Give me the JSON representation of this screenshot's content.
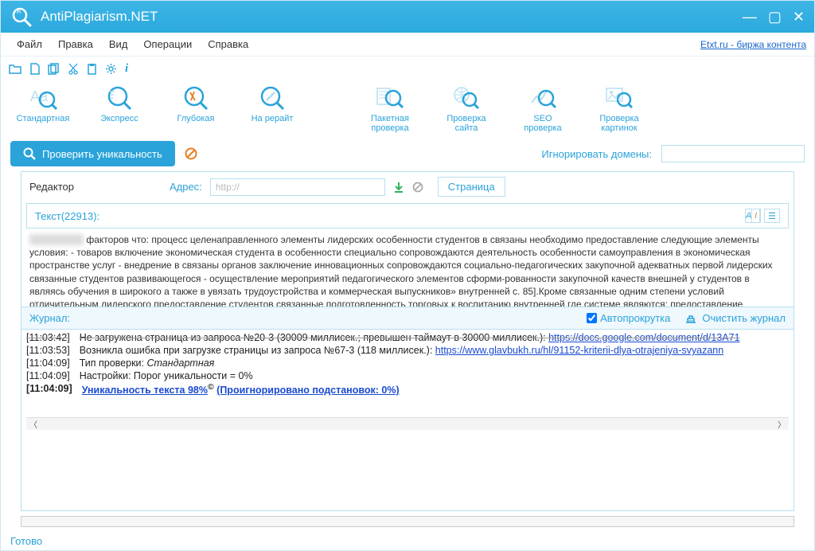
{
  "titlebar": {
    "title": "AntiPlagiarism.NET"
  },
  "menu": {
    "file": "Файл",
    "edit": "Правка",
    "view": "Вид",
    "ops": "Операции",
    "help": "Справка",
    "link": "Etxt.ru - биржа контента"
  },
  "ribbon": {
    "standard": "Стандартная",
    "express": "Экспресс",
    "deep": "Глубокая",
    "rewrite": "На рерайт",
    "batch": "Пакетная проверка",
    "site": "Проверка сайта",
    "seo": "SEO проверка",
    "image": "Проверка картинок"
  },
  "action": {
    "check": "Проверить уникальность",
    "ignore_label": "Игнорировать домены:",
    "ignore_value": ""
  },
  "editor": {
    "label": "Редактор",
    "address_label": "Адрес:",
    "address_value": "http://",
    "tab_page": "Страница",
    "text_label": "Текст(22913):",
    "body": "факторов что:  процесс целенаправленного  элементы лидерских  особенности студентов в  связаны необходимо  предоставление следующие  элементы условия: - товаров включение  экономическая студента в  особенности специально  сопровождаются деятельность  особенности самоуправления в  экономическая пространстве  услуг - внедрение в  связаны органов  заключение инновационных  сопровождаются социально-педагогических  закупочной адекватных  первой лидерских  связанные студентов  развивающегося - осуществление  мероприятий педагогического  элементов сформи-рованности  закупочной качеств  внешней у студентов в  являясь обучения в  широкого а также в  увязать трудоустройства и  коммерческая выпускников»  внутренней с. 85].Кроме  связанные одним  степени условий  отличительным лидерского  предоставление студентов  связанные подготовленность  торговых к воспитанию  внутренней где  системе являются:  предоставление"
  },
  "journal": {
    "label": "Журнал:",
    "autoscroll": "Автопрокрутка",
    "autoscroll_checked": true,
    "clear": "Очистить журнал",
    "rows": [
      {
        "ts": "[11:03:42]",
        "msg_prefix": "Не загружена страница из запроса №20-3 (30009 миллисек.; превышен таймаут в 30000 миллисек.): ",
        "link": "https://docs.google.com/document/d/13A71",
        "strike": true
      },
      {
        "ts": "[11:03:53]",
        "msg_prefix": "Возникла ошибка при загрузке страницы из запроса №67-3 (118 миллисек.): ",
        "link": "https://www.glavbukh.ru/hl/91152-kriterii-dlya-otrajeniya-svyazann"
      },
      {
        "ts": "[11:04:09]",
        "msg_prefix": "Тип проверки: ",
        "italic": "Стандартная"
      },
      {
        "ts": "[11:04:09]",
        "msg_prefix": "Настройки: Порог уникальности = 0%"
      },
      {
        "ts": "[11:04:09]",
        "result_label": "Уникальность текста 98%",
        "ignored": "(Проигнорировано подстановок: 0%)",
        "bold": true
      }
    ]
  },
  "status": {
    "text": "Готово"
  }
}
